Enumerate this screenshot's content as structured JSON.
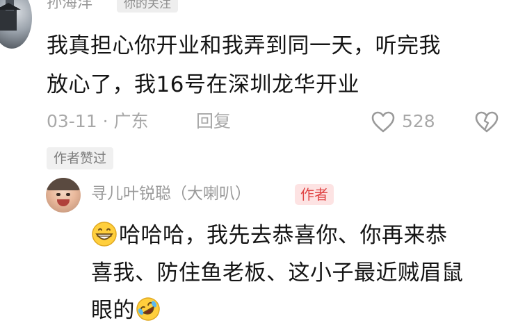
{
  "comment": {
    "username": "孙海洋",
    "follow_tag": "你的关注",
    "text_line1": "我真担心你开业和我弄到同一天，听完我",
    "text_line2": "放心了，我16号在深圳龙华开业",
    "meta": "03-11 · 广东",
    "reply_label": "回复",
    "likes": "528",
    "liked_by_author": "作者赞过"
  },
  "reply": {
    "username": "寻儿叶锐聪（大喇叭）",
    "author_tag": "作者",
    "text_line1": "哈哈哈，我先去恭喜你、你再来恭",
    "text_line2": "喜我、防住鱼老板、这小子最近贼眉鼠",
    "text_line3": "眼的",
    "emoji_start": "grinning-face",
    "emoji_end": "rolling-laughing-face"
  },
  "colors": {
    "text_primary": "#141414",
    "text_secondary": "#a8a8a8",
    "author_tag_text": "#e04545",
    "author_tag_bg": "#fde3e3"
  }
}
